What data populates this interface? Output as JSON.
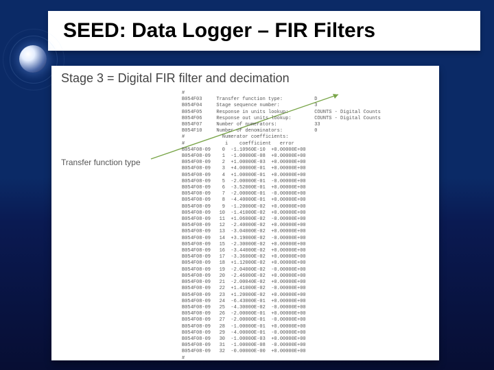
{
  "title": "SEED: Data Logger – FIR Filters",
  "stage_heading": "Stage 3 = Digital FIR filter and decimation",
  "callout_label": "Transfer function type",
  "header_fields": [
    {
      "key": "B054F03",
      "label": "Transfer function type:",
      "value": "D"
    },
    {
      "key": "B054F04",
      "label": "Stage sequence number:",
      "value": "3"
    },
    {
      "key": "B054F05",
      "label": "Response in units lookup:",
      "value": "COUNTS - Digital Counts"
    },
    {
      "key": "B054F06",
      "label": "Response out units lookup:",
      "value": "COUNTS - Digital Counts"
    },
    {
      "key": "B054F07",
      "label": "Number of numerators:",
      "value": "33"
    },
    {
      "key": "B054F10",
      "label": "Number of denominators:",
      "value": "0"
    }
  ],
  "numerator_heading": "Numerator coefficients:",
  "col_headers": [
    "i",
    "coefficient",
    "error"
  ],
  "coeff_key": "B054F08-09",
  "coefficients": [
    {
      "i": 0,
      "coeff": "-1.10960E-10",
      "err": "+0.00000E+00"
    },
    {
      "i": 1,
      "coeff": "-1.00000E-08",
      "err": "+0.00000E+00"
    },
    {
      "i": 2,
      "coeff": "+1.00000E-03",
      "err": "+0.00000E+00"
    },
    {
      "i": 3,
      "coeff": "+4.00000E-01",
      "err": "+0.00000E+00"
    },
    {
      "i": 4,
      "coeff": "+1.00000E-01",
      "err": "+0.00000E+00"
    },
    {
      "i": 5,
      "coeff": "-2.00000E-01",
      "err": "-0.00000E+00"
    },
    {
      "i": 6,
      "coeff": "-3.52000E-01",
      "err": "+0.00000E+00"
    },
    {
      "i": 7,
      "coeff": "-2.00000E-01",
      "err": "-0.00000E+00"
    },
    {
      "i": 8,
      "coeff": "-4.40000E-01",
      "err": "+0.00000E+00"
    },
    {
      "i": 9,
      "coeff": "-1.20000E-02",
      "err": "+0.00000E+00"
    },
    {
      "i": 10,
      "coeff": "-1.41000E-02",
      "err": "+0.00000E+00"
    },
    {
      "i": 11,
      "coeff": "+1.06000E-02",
      "err": "-0.00000E+00"
    },
    {
      "i": 12,
      "coeff": "-2.40000E-02",
      "err": "+0.00000E+00"
    },
    {
      "i": 13,
      "coeff": "-3.04000E-02",
      "err": "+0.00000E+00"
    },
    {
      "i": 14,
      "coeff": "+3.19000E-02",
      "err": "-0.00000E+00"
    },
    {
      "i": 15,
      "coeff": "-2.30000E-02",
      "err": "+0.00000E+00"
    },
    {
      "i": 16,
      "coeff": "-3.44000E-02",
      "err": "+0.00000E+00"
    },
    {
      "i": 17,
      "coeff": "-3.36000E-02",
      "err": "+0.00000E+00"
    },
    {
      "i": 18,
      "coeff": "+1.12000E-02",
      "err": "+0.00000E+00"
    },
    {
      "i": 19,
      "coeff": "-2.04000E-02",
      "err": "-0.00000E+00"
    },
    {
      "i": 20,
      "coeff": "-2.46000E-02",
      "err": "+0.00000E+00"
    },
    {
      "i": 21,
      "coeff": "-2.00040E-02",
      "err": "+0.00000E+00"
    },
    {
      "i": 22,
      "coeff": "+1.41000E-02",
      "err": "-0.00000E+00"
    },
    {
      "i": 23,
      "coeff": "+1.20000E-02",
      "err": "+0.00000E+00"
    },
    {
      "i": 24,
      "coeff": "-6.43000E-01",
      "err": "+0.00000E+00"
    },
    {
      "i": 25,
      "coeff": "-4.30000E-02",
      "err": "-0.00000E+00"
    },
    {
      "i": 26,
      "coeff": "-2.00000E-01",
      "err": "+0.00000E+00"
    },
    {
      "i": 27,
      "coeff": "-2.00000E-01",
      "err": "-0.00000E+00"
    },
    {
      "i": 28,
      "coeff": "-1.00000E-01",
      "err": "+0.00000E+00"
    },
    {
      "i": 29,
      "coeff": "-4.00000E-01",
      "err": "-0.00000E+00"
    },
    {
      "i": 30,
      "coeff": "-1.00000E-03",
      "err": "+0.00000E+00"
    },
    {
      "i": 31,
      "coeff": "-1.00000E-08",
      "err": "-0.00000E+00"
    },
    {
      "i": 32,
      "coeff": "-0.00000E-00",
      "err": "+0.00000E+00"
    }
  ]
}
